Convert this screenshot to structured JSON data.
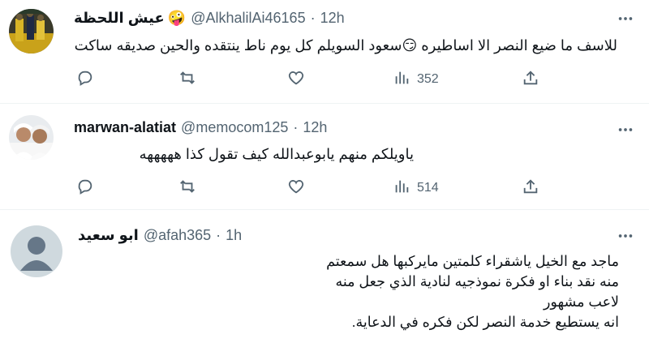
{
  "tweets": [
    {
      "display_name": "عيش اللحظة",
      "name_emoji": "🤪",
      "handle": "@AlkhalilAi46165",
      "separator": "·",
      "time": "12h",
      "text": "للاسف ما ضيع النصر الا اساطيره 😏سعود السويلم كل يوم ناط ينتقده والحين صديقه ساكت",
      "views": "352"
    },
    {
      "display_name": "marwan-alatiat",
      "handle": "@memocom125",
      "separator": "·",
      "time": "12h",
      "text": "ياويلكم منهم يابوعبدالله كيف تقول كذا هههههه",
      "views": "514"
    },
    {
      "display_name": "ابو سعيد",
      "handle": "@afah365",
      "separator": "·",
      "time": "1h",
      "text_lines": [
        "ماجد مع الخيل ياشقراء كلمتين مايركبها هل سمعتم",
        "منه نقد بناء او فكرة نموذجيه لنادية الذي جعل منه",
        "لاعب مشهور",
        "انه يستطيع خدمة النصر لكن فكره في الدعاية."
      ]
    }
  ],
  "icons": {
    "reply": "reply-icon",
    "retweet": "retweet-icon",
    "like": "heart-icon",
    "views": "views-chart-icon",
    "share": "share-icon",
    "more": "more-options-icon"
  },
  "colors": {
    "text": "#0f1419",
    "secondary": "#536471",
    "divider": "#eff3f4"
  }
}
